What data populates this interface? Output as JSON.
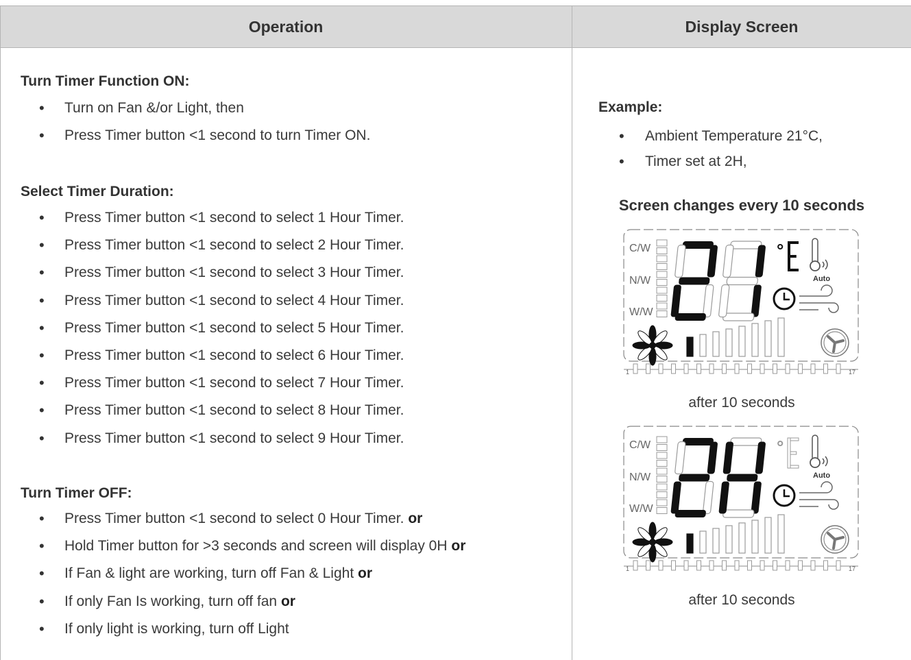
{
  "header": {
    "operation": "Operation",
    "display_screen": "Display Screen"
  },
  "left": {
    "sections": [
      {
        "title": "Turn Timer Function ON:",
        "items": [
          {
            "text": "Turn on Fan &/or Light, then",
            "suffix": ""
          },
          {
            "text": "Press Timer button <1 second to turn Timer ON.",
            "suffix": ""
          }
        ]
      },
      {
        "title": "Select Timer Duration:",
        "items": [
          {
            "text": "Press Timer button <1 second to select 1 Hour Timer.",
            "suffix": ""
          },
          {
            "text": "Press Timer button <1 second to select 2 Hour Timer.",
            "suffix": ""
          },
          {
            "text": "Press Timer button <1 second to select 3 Hour Timer.",
            "suffix": ""
          },
          {
            "text": "Press Timer button <1 second to select 4 Hour Timer.",
            "suffix": ""
          },
          {
            "text": "Press Timer button <1 second to select 5 Hour Timer.",
            "suffix": ""
          },
          {
            "text": "Press Timer button <1 second to select 6 Hour Timer.",
            "suffix": ""
          },
          {
            "text": "Press Timer button <1 second to select 7 Hour Timer.",
            "suffix": ""
          },
          {
            "text": "Press Timer button <1 second to select 8 Hour Timer.",
            "suffix": ""
          },
          {
            "text": "Press Timer button <1 second to select 9 Hour Timer.",
            "suffix": ""
          }
        ]
      },
      {
        "title": "Turn Timer OFF:",
        "items": [
          {
            "text": "Press Timer button <1 second to select 0 Hour Timer.",
            "suffix": "or"
          },
          {
            "text": "Hold Timer button for >3 seconds and screen will display 0H",
            "suffix": "or"
          },
          {
            "text": "If Fan & light are working, turn off Fan & Light",
            "suffix": "or"
          },
          {
            "text": "If only Fan Is working, turn off fan",
            "suffix": "or"
          },
          {
            "text": "If only light is working, turn off Light",
            "suffix": ""
          }
        ]
      }
    ]
  },
  "right": {
    "example_title": "Example:",
    "example_items": [
      "Ambient Temperature 21°C,",
      "Timer set at 2H,"
    ],
    "screen_title": "Screen changes every 10 seconds",
    "screens": [
      {
        "digits": "21",
        "unit_active": true,
        "caption": "after 10 seconds"
      },
      {
        "digits": "2H",
        "unit_active": false,
        "caption": "after 10 seconds"
      }
    ],
    "lcd_labels": {
      "cw": "C/W",
      "nw": "N/W",
      "ww": "W/W",
      "auto": "Auto",
      "bar_start": "1",
      "bar_end": "17",
      "degree": "°"
    },
    "colors": {
      "lcd_on": "#111111",
      "lcd_off": "#9a9a9a"
    }
  }
}
